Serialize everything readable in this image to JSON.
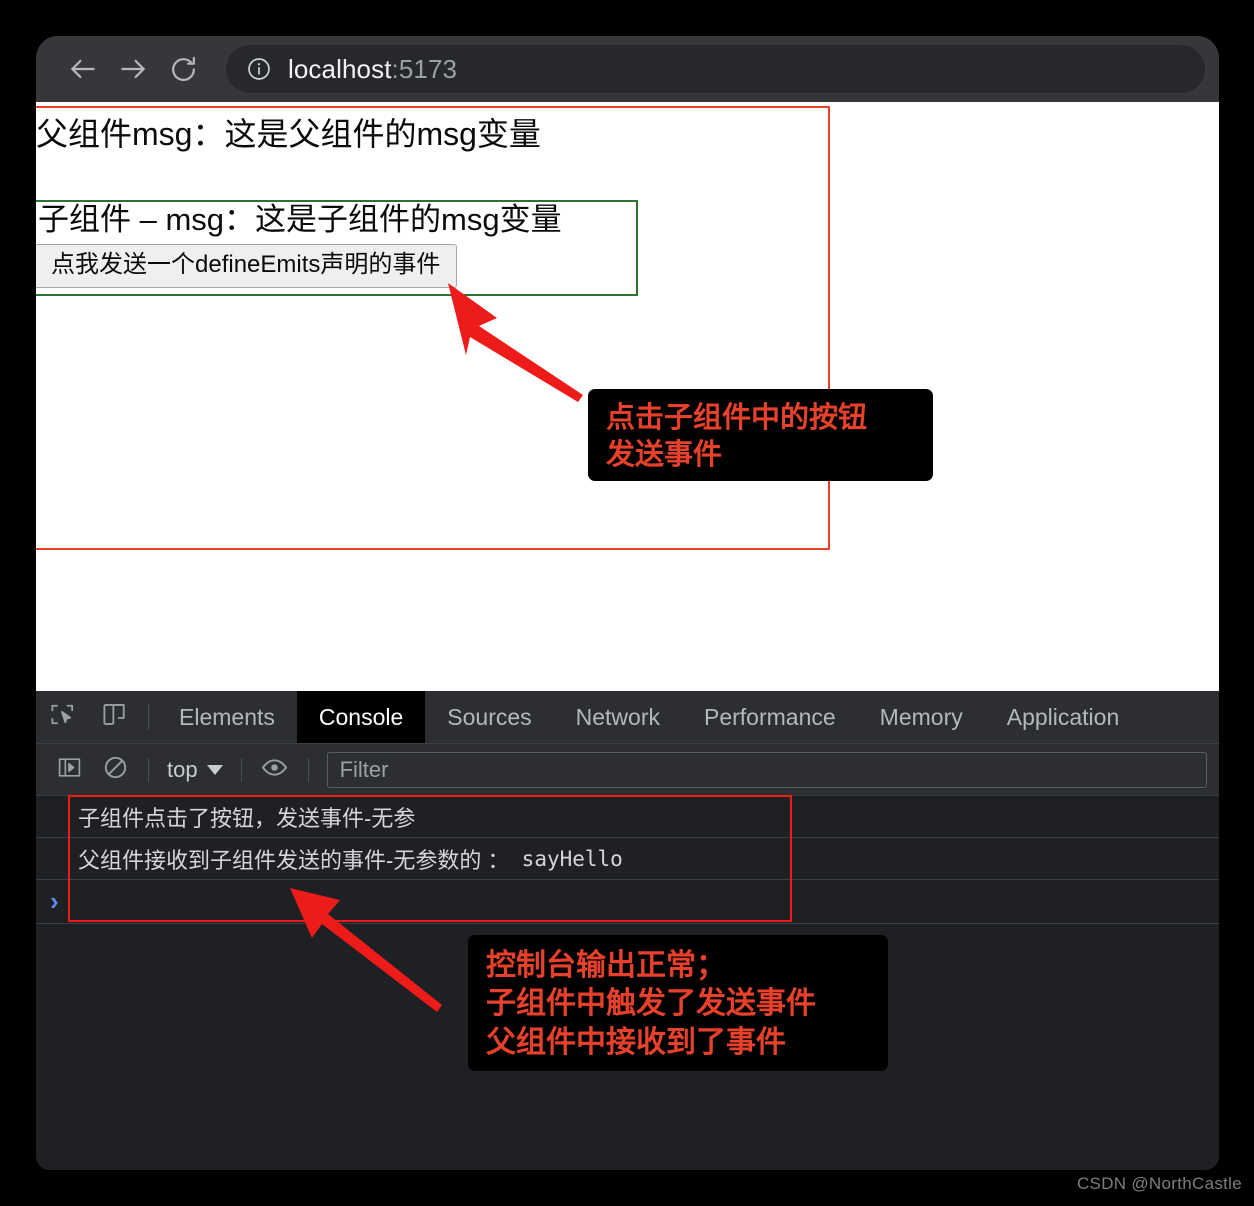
{
  "browser": {
    "nav": {
      "back_icon": "arrow-left-icon",
      "forward_icon": "arrow-right-icon",
      "reload_icon": "reload-icon"
    },
    "omnibox": {
      "info_icon": "info-circle-icon",
      "host": "localhost",
      "port": ":5173"
    }
  },
  "page": {
    "parent_text": "父组件msg：这是父组件的msg变量",
    "child_text": "子组件 – msg：这是子组件的msg变量",
    "emit_button": "点我发送一个defineEmits声明的事件",
    "parent_border_color": "#e8412b",
    "child_border_color": "#2e7031"
  },
  "annotations": [
    {
      "id": "callout-click-child-button",
      "text": "点击子组件中的按钮\n发送事件",
      "color": "#e8412b",
      "background": "#000000"
    },
    {
      "id": "callout-console-output",
      "text": "控制台输出正常；\n子组件中触发了发送事件\n父组件中接收到了事件",
      "color": "#e8412b",
      "background": "#000000"
    }
  ],
  "devtools": {
    "inspect_icon": "cursor-select-icon",
    "device_toolbar_icon": "device-toggle-icon",
    "tabs": [
      {
        "label": "Elements",
        "active": false
      },
      {
        "label": "Console",
        "active": true
      },
      {
        "label": "Sources",
        "active": false
      },
      {
        "label": "Network",
        "active": false
      },
      {
        "label": "Performance",
        "active": false
      },
      {
        "label": "Memory",
        "active": false
      },
      {
        "label": "Application",
        "active": false
      }
    ],
    "filterbar": {
      "sidebar_icon": "console-sidebar-icon",
      "clear_icon": "clear-console-icon",
      "context": "top",
      "context_caret_icon": "chevron-down-icon",
      "eye_icon": "live-expression-eye-icon",
      "filter_placeholder": "Filter"
    },
    "console_messages": [
      {
        "text": "子组件点击了按钮，发送事件-无参",
        "mono": ""
      },
      {
        "text": "父组件接收到子组件发送的事件-无参数的 ：  ",
        "mono": "sayHello"
      }
    ],
    "prompt_caret": "›",
    "highlight_color": "#ee1b1b"
  },
  "watermark": "CSDN @NorthCastle"
}
